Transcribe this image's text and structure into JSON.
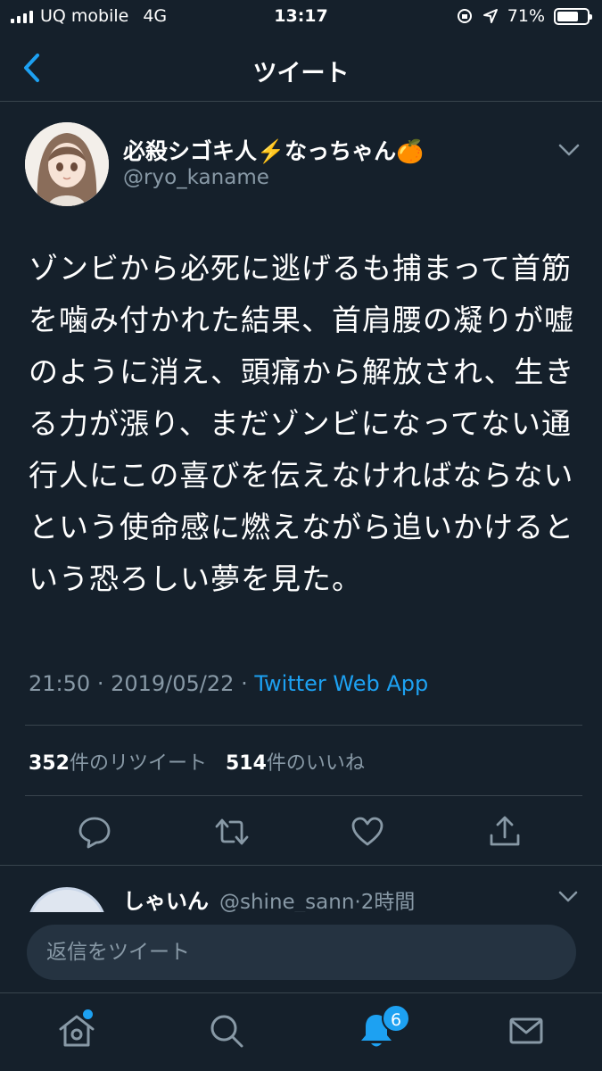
{
  "status_bar": {
    "carrier": "UQ mobile",
    "network": "4G",
    "time": "13:17",
    "battery": "71%",
    "battery_level": 0.71
  },
  "header": {
    "title": "ツイート"
  },
  "tweet": {
    "display_name": "必殺シゴキ人⚡️なっちゃん🍊",
    "handle": "@ryo_kaname",
    "text": "ゾンビから必死に逃げるも捕まって首筋を噛み付かれた結果、首肩腰の凝りが嘘のように消え、頭痛から解放され、生きる力が漲り、まだゾンビになってない通行人にこの喜びを伝えなければならないという使命感に燃えながら追いかけるという恐ろしい夢を見た。",
    "time": "21:50",
    "separator": "·",
    "date": "2019/05/22",
    "source": "Twitter Web App",
    "retweet_count": "352",
    "retweet_label": "件のリツイート",
    "like_count": "514",
    "like_label": "件のいいね"
  },
  "reply": {
    "display_name": "しゃいん",
    "handle": "@shine_sann",
    "time_ago": "2時間"
  },
  "compose": {
    "placeholder": "返信をツイート"
  },
  "tab_bar": {
    "notification_badge": "6"
  },
  "colors": {
    "background": "#15202b",
    "accent": "#1da1f2",
    "secondary_text": "#8899a6",
    "divider": "#38444d"
  }
}
